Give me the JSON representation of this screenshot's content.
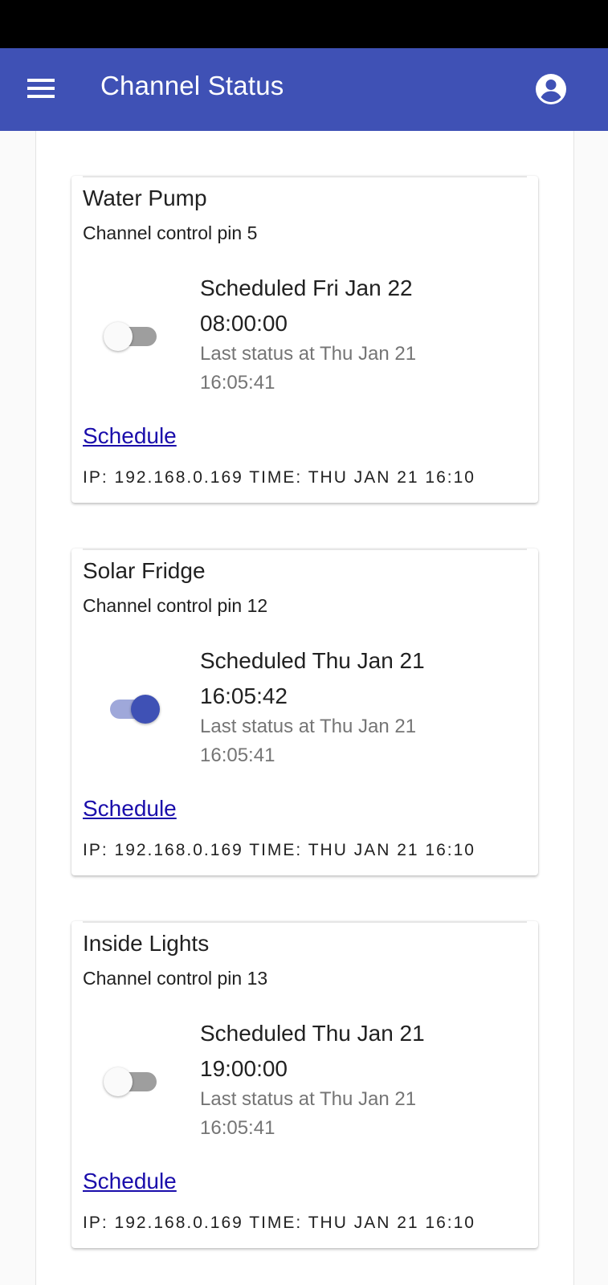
{
  "app_bar": {
    "title": "Channel Status",
    "menu_icon": "hamburger-menu-icon",
    "account_icon": "account-circle-icon",
    "color": "#3f51b5"
  },
  "channels": [
    {
      "name": "Water Pump",
      "control_pin": "Channel control pin 5",
      "toggle_on": false,
      "scheduled": "Scheduled Fri Jan 22 08:00:00",
      "last_status": "Last status at Thu Jan 21 16:05:41",
      "schedule_link": "Schedule",
      "footer": "IP: 192.168.0.169 TIME: THU JAN 21 16:10"
    },
    {
      "name": "Solar Fridge",
      "control_pin": "Channel control pin 12",
      "toggle_on": true,
      "scheduled": "Scheduled Thu Jan 21 16:05:42",
      "last_status": "Last status at Thu Jan 21 16:05:41",
      "schedule_link": "Schedule",
      "footer": "IP: 192.168.0.169 TIME: THU JAN 21 16:10"
    },
    {
      "name": "Inside Lights",
      "control_pin": "Channel control pin 13",
      "toggle_on": false,
      "scheduled": "Scheduled Thu Jan 21 19:00:00",
      "last_status": "Last status at Thu Jan 21 16:05:41",
      "schedule_link": "Schedule",
      "footer": "IP: 192.168.0.169 TIME: THU JAN 21 16:10"
    }
  ]
}
